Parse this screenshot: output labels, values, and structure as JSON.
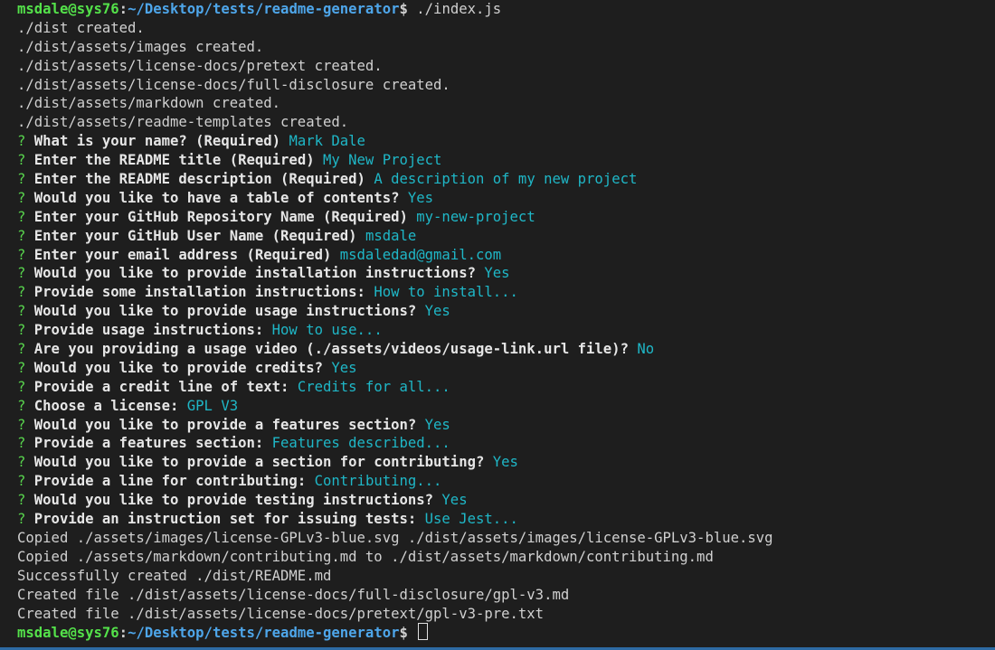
{
  "prompt": {
    "user_host": "msdale@sys76",
    "colon": ":",
    "path": "~/Desktop/tests/readme-generator",
    "dollar": "$"
  },
  "command": " ./index.js",
  "created_lines": [
    "./dist created.",
    "./dist/assets/images created.",
    "./dist/assets/license-docs/pretext created.",
    "./dist/assets/license-docs/full-disclosure created.",
    "./dist/assets/markdown created.",
    "./dist/assets/readme-templates created."
  ],
  "qa": [
    {
      "q": "What is your name? (Required)",
      "a": "Mark Dale"
    },
    {
      "q": "Enter the README title (Required)",
      "a": "My New Project"
    },
    {
      "q": "Enter the README description (Required)",
      "a": "A description of my new project"
    },
    {
      "q": "Would you like to have a table of contents?",
      "a": "Yes"
    },
    {
      "q": "Enter your GitHub Repository Name (Required)",
      "a": "my-new-project"
    },
    {
      "q": "Enter your GitHub User Name (Required)",
      "a": "msdale"
    },
    {
      "q": "Enter your email address (Required)",
      "a": "msdaledad@gmail.com"
    },
    {
      "q": "Would you like to provide installation instructions?",
      "a": "Yes"
    },
    {
      "q": "Provide some installation instructions:",
      "a": "How to install..."
    },
    {
      "q": "Would you like to provide usage instructions?",
      "a": "Yes"
    },
    {
      "q": "Provide usage instructions:",
      "a": "How to use..."
    },
    {
      "q": "Are you providing a usage video (./assets/videos/usage-link.url file)?",
      "a": "No"
    },
    {
      "q": "Would you like to provide credits?",
      "a": "Yes"
    },
    {
      "q": "Provide a credit line of text:",
      "a": "Credits for all..."
    },
    {
      "q": "Choose a license:",
      "a": "GPL V3"
    },
    {
      "q": "Would you like to provide a features section?",
      "a": "Yes"
    },
    {
      "q": "Provide a features section:",
      "a": "Features described..."
    },
    {
      "q": "Would you like to provide a section for contributing?",
      "a": "Yes"
    },
    {
      "q": "Provide a line for contributing:",
      "a": "Contributing..."
    },
    {
      "q": "Would you like to provide testing instructions?",
      "a": "Yes"
    },
    {
      "q": "Provide an instruction set for issuing tests:",
      "a": "Use Jest..."
    }
  ],
  "result_lines": [
    "Copied ./assets/images/license-GPLv3-blue.svg ./dist/assets/images/license-GPLv3-blue.svg",
    "Copied ./assets/markdown/contributing.md to ./dist/assets/markdown/contributing.md",
    "Successfully created ./dist/README.md",
    "Created file ./dist/assets/license-docs/full-disclosure/gpl-v3.md",
    "Created file ./dist/assets/license-docs/pretext/gpl-v3-pre.txt"
  ],
  "qmark": "? ",
  "colors": {
    "background": "#1e1e1e",
    "prompt_user": "#54e24a",
    "prompt_path": "#4ea6ea",
    "answer": "#1fb7c7",
    "text": "#d0d0d0"
  }
}
